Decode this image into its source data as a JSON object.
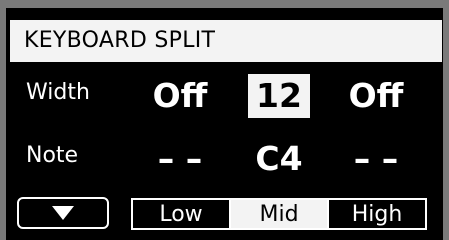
{
  "title": "KEYBOARD SPLIT",
  "rows": {
    "width": {
      "label": "Width",
      "low": "Off",
      "mid": "12",
      "high": "Off"
    },
    "note": {
      "label": "Note",
      "low": "– –",
      "mid": "C4",
      "high": "– –"
    }
  },
  "selected_cell": "width.mid",
  "down_button_icon": "triangle-down-icon",
  "ranges": {
    "low": "Low",
    "mid": "Mid",
    "high": "High",
    "active": "Mid"
  },
  "colors": {
    "background": "#000000",
    "highlight": "#f3f3f3",
    "bezel": "#7a7a7a"
  }
}
